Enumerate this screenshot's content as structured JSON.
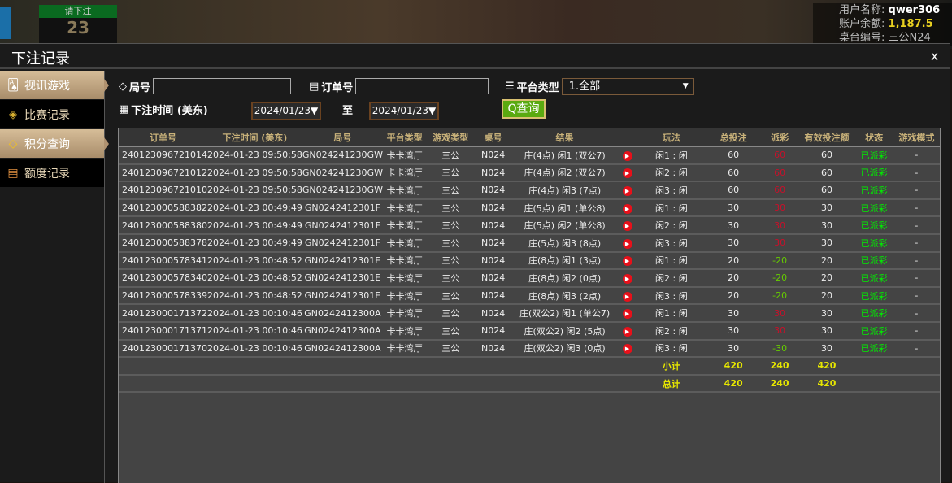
{
  "background": {
    "bet_prompt": "请下注",
    "countdown": "23",
    "user_label": "用户名称:",
    "username": "qwer306",
    "balance_label": "账户余额:",
    "balance": "1,187.5",
    "table_label": "桌台编号:",
    "table": "三公N24"
  },
  "modal": {
    "title": "下注记录",
    "close": "x"
  },
  "sidebar": {
    "items": [
      {
        "label": "视讯游戏",
        "icon": "cards-icon"
      },
      {
        "label": "比赛记录",
        "icon": "ticket-icon"
      },
      {
        "label": "积分查询",
        "icon": "diamond-icon"
      },
      {
        "label": "额度记录",
        "icon": "document-icon"
      }
    ]
  },
  "filters": {
    "round_label": "局号",
    "round_value": "",
    "order_label": "订单号",
    "order_value": "",
    "platform_label": "平台类型",
    "platform_value": "1.全部",
    "time_label": "下注时间 (美东)",
    "date_from": "2024/01/23▼",
    "to_label": "至",
    "date_to": "2024/01/23▼",
    "query_label": "查询"
  },
  "table": {
    "headers": [
      "订单号",
      "下注时间 (美东)",
      "局号",
      "平台类型",
      "游戏类型",
      "桌号",
      "结果",
      "",
      "玩法",
      "总投注",
      "派彩",
      "有效投注额",
      "状态",
      "游戏模式"
    ],
    "rows": [
      [
        "240123096721014",
        "2024-01-23 09:50:58",
        "GN024241230GW",
        "卡卡湾厅",
        "三公",
        "N024",
        "庄(4点) 闲1 (双公7)",
        "闲1 : 闲",
        "60",
        "60",
        "60",
        "已派彩",
        "-"
      ],
      [
        "240123096721012",
        "2024-01-23 09:50:58",
        "GN024241230GW",
        "卡卡湾厅",
        "三公",
        "N024",
        "庄(4点) 闲2 (双公7)",
        "闲2 : 闲",
        "60",
        "60",
        "60",
        "已派彩",
        "-"
      ],
      [
        "240123096721010",
        "2024-01-23 09:50:58",
        "GN024241230GW",
        "卡卡湾厅",
        "三公",
        "N024",
        "庄(4点) 闲3 (7点)",
        "闲3 : 闲",
        "60",
        "60",
        "60",
        "已派彩",
        "-"
      ],
      [
        "240123000588382",
        "2024-01-23 00:49:49",
        "GN0242412301F",
        "卡卡湾厅",
        "三公",
        "N024",
        "庄(5点) 闲1 (单公8)",
        "闲1 : 闲",
        "30",
        "30",
        "30",
        "已派彩",
        "-"
      ],
      [
        "240123000588380",
        "2024-01-23 00:49:49",
        "GN0242412301F",
        "卡卡湾厅",
        "三公",
        "N024",
        "庄(5点) 闲2 (单公8)",
        "闲2 : 闲",
        "30",
        "30",
        "30",
        "已派彩",
        "-"
      ],
      [
        "240123000588378",
        "2024-01-23 00:49:49",
        "GN0242412301F",
        "卡卡湾厅",
        "三公",
        "N024",
        "庄(5点) 闲3 (8点)",
        "闲3 : 闲",
        "30",
        "30",
        "30",
        "已派彩",
        "-"
      ],
      [
        "240123000578341",
        "2024-01-23 00:48:52",
        "GN0242412301E",
        "卡卡湾厅",
        "三公",
        "N024",
        "庄(8点) 闲1 (3点)",
        "闲1 : 闲",
        "20",
        "-20",
        "20",
        "已派彩",
        "-"
      ],
      [
        "240123000578340",
        "2024-01-23 00:48:52",
        "GN0242412301E",
        "卡卡湾厅",
        "三公",
        "N024",
        "庄(8点) 闲2 (0点)",
        "闲2 : 闲",
        "20",
        "-20",
        "20",
        "已派彩",
        "-"
      ],
      [
        "240123000578339",
        "2024-01-23 00:48:52",
        "GN0242412301E",
        "卡卡湾厅",
        "三公",
        "N024",
        "庄(8点) 闲3 (2点)",
        "闲3 : 闲",
        "20",
        "-20",
        "20",
        "已派彩",
        "-"
      ],
      [
        "240123000171372",
        "2024-01-23 00:10:46",
        "GN0242412300A",
        "卡卡湾厅",
        "三公",
        "N024",
        "庄(双公2) 闲1 (单公7)",
        "闲1 : 闲",
        "30",
        "30",
        "30",
        "已派彩",
        "-"
      ],
      [
        "240123000171371",
        "2024-01-23 00:10:46",
        "GN0242412300A",
        "卡卡湾厅",
        "三公",
        "N024",
        "庄(双公2) 闲2 (5点)",
        "闲2 : 闲",
        "30",
        "30",
        "30",
        "已派彩",
        "-"
      ],
      [
        "240123000171370",
        "2024-01-23 00:10:46",
        "GN0242412300A",
        "卡卡湾厅",
        "三公",
        "N024",
        "庄(双公2) 闲3 (0点)",
        "闲3 : 闲",
        "30",
        "-30",
        "30",
        "已派彩",
        "-"
      ]
    ],
    "totals": [
      {
        "label": "小计",
        "bet": "420",
        "payout": "240",
        "valid": "420"
      },
      {
        "label": "总计",
        "bet": "420",
        "payout": "240",
        "valid": "420"
      }
    ]
  },
  "colors": {
    "header_text": "#c9b27a",
    "payout_win": "#c8102a",
    "payout_loss": "#66cc00",
    "status": "#00ee00",
    "totals": "#e6e600"
  }
}
